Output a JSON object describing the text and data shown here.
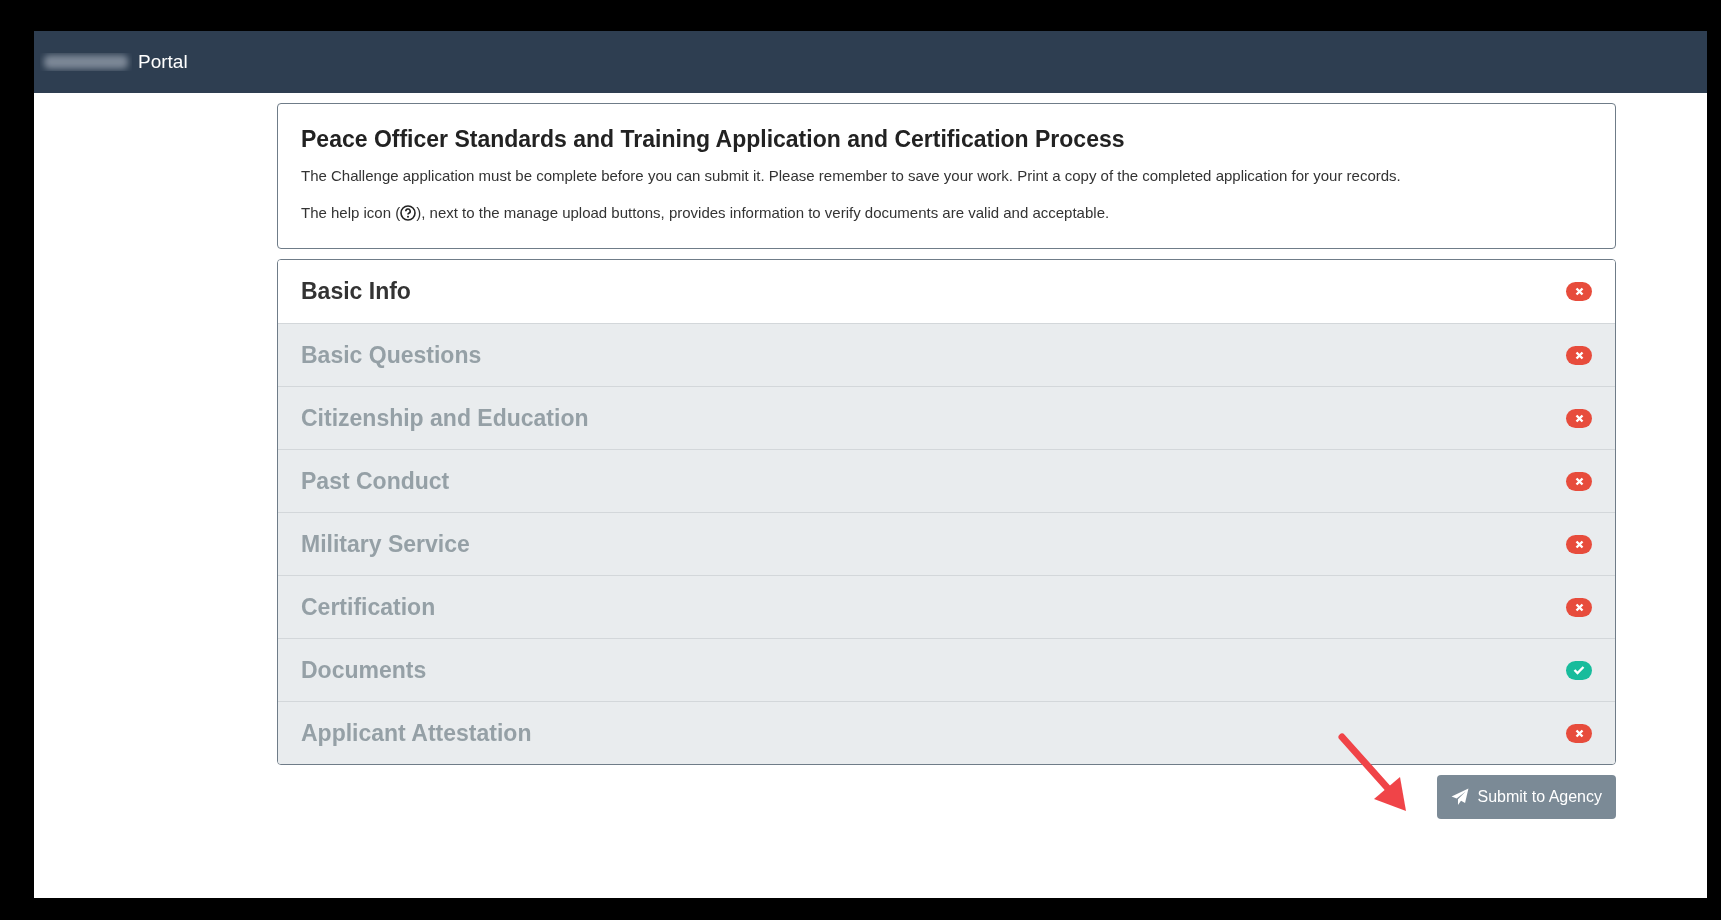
{
  "header": {
    "title": "Portal"
  },
  "intro": {
    "title": "Peace Officer Standards and Training Application and Certification Process",
    "paragraph": "The Challenge application must be complete before you can submit it. Please remember to save your work. Print a copy of the completed application for your records.",
    "help_note": {
      "before": "The help icon (",
      "after": "), next to the manage upload buttons, provides information to verify documents are valid and acceptable."
    }
  },
  "sections": [
    {
      "label": "Basic Info",
      "selected": true,
      "complete": false
    },
    {
      "label": "Basic Questions",
      "selected": false,
      "complete": false
    },
    {
      "label": "Citizenship and Education",
      "selected": false,
      "complete": false
    },
    {
      "label": "Past Conduct",
      "selected": false,
      "complete": false
    },
    {
      "label": "Military Service",
      "selected": false,
      "complete": false
    },
    {
      "label": "Certification",
      "selected": false,
      "complete": false
    },
    {
      "label": "Documents",
      "selected": false,
      "complete": true
    },
    {
      "label": "Applicant Attestation",
      "selected": false,
      "complete": false
    }
  ],
  "submit_button": {
    "label": "Submit to Agency"
  }
}
